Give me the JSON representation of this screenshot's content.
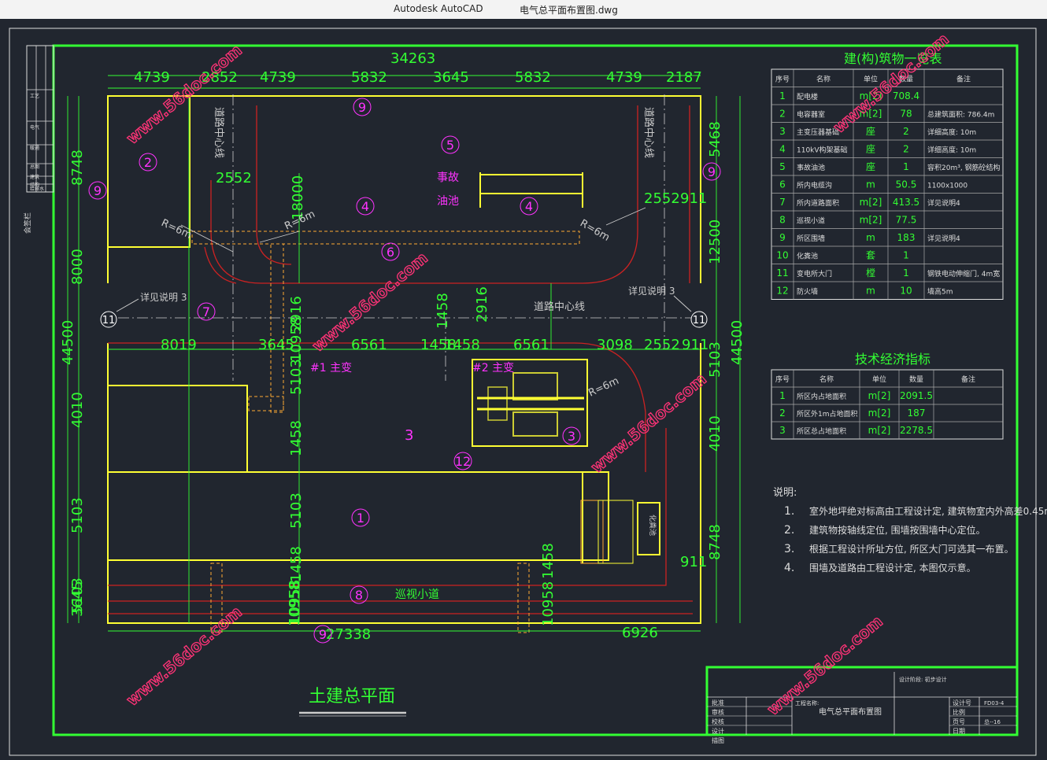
{
  "window": {
    "app_name": "Autodesk AutoCAD",
    "file_name": "电气总平面布置图.dwg"
  },
  "colors": {
    "background": "#21262f",
    "frame": "#33ff33",
    "building": "#ffff33",
    "dimension": "#33ff33",
    "wall": "#cc2222",
    "label": "#ff33ff",
    "watermark": "#ff3377",
    "axis": "#cccccc"
  },
  "drawing": {
    "top_dims": [
      "34263",
      "4739",
      "2852",
      "4739",
      "5832",
      "3645",
      "5832",
      "4739",
      "2187"
    ],
    "left_dims": [
      "8748",
      "8000",
      "44500",
      "4010",
      "5103",
      "5103",
      "3645"
    ],
    "right_dims": [
      "5468",
      "12500",
      "44500",
      "5103",
      "4010",
      "8748"
    ],
    "inner_dims": [
      "2552",
      "18000",
      "2552",
      "911",
      "2916",
      "10958",
      "1458",
      "2916",
      "8019",
      "3645",
      "6561",
      "1458",
      "1458",
      "6561",
      "3098",
      "2552",
      "911",
      "5103",
      "1458",
      "5103",
      "1458",
      "10958",
      "10958",
      "1458",
      "27338",
      "6926",
      "10958",
      "911"
    ],
    "radius_labels": [
      "R=6m",
      "R=6m",
      "R=6m",
      "R=6m"
    ],
    "road_labels": [
      "道路中心线",
      "道路中心线",
      "道路中心线"
    ],
    "callouts": [
      "详见说明 3",
      "详见说明 3"
    ],
    "axis_bubbles": [
      "11",
      "11"
    ],
    "area_labels": {
      "oil_pool_line1": "事故",
      "oil_pool_line2": "油池",
      "transformer1": "#1 主变",
      "transformer2": "#2 主变",
      "patrol_road": "巡视小道",
      "area3": "3",
      "septic": "化粪池"
    },
    "circled_numbers": [
      "9",
      "5",
      "2",
      "9",
      "9",
      "4",
      "4",
      "6",
      "7",
      "3",
      "12",
      "1",
      "8",
      "9"
    ],
    "title": "土建总平面",
    "side_stamp": "会签栏",
    "left_panel_labels": [
      "工艺",
      "电气",
      "暖通",
      "总图",
      "建筑",
      "结构",
      "给排水"
    ]
  },
  "buildings_table": {
    "title": "建(构)筑物一览表",
    "headers": [
      "序号",
      "名称",
      "单位",
      "数量",
      "备注"
    ],
    "rows": [
      [
        "1",
        "配电楼",
        "m[2]",
        "708.4",
        ""
      ],
      [
        "2",
        "电容器室",
        "m[2]",
        "78",
        "总建筑面积: 786.4m"
      ],
      [
        "3",
        "主变压器基础",
        "座",
        "2",
        "详细高度: 10m"
      ],
      [
        "4",
        "110kV构架基础",
        "座",
        "2",
        "详细高度: 10m"
      ],
      [
        "5",
        "事故油池",
        "座",
        "1",
        "容积20m³, 钢筋砼结构"
      ],
      [
        "6",
        "所内电缆沟",
        "m",
        "50.5",
        "1100x1000"
      ],
      [
        "7",
        "所内道路面积",
        "m[2]",
        "413.5",
        "详见说明4"
      ],
      [
        "8",
        "巡视小道",
        "m[2]",
        "77.5",
        ""
      ],
      [
        "9",
        "所区围墙",
        "m",
        "183",
        "详见说明4"
      ],
      [
        "10",
        "化粪池",
        "套",
        "1",
        ""
      ],
      [
        "11",
        "变电所大门",
        "樘",
        "1",
        "钢铁电动伸缩门, 4m宽"
      ],
      [
        "12",
        "防火墙",
        "m",
        "10",
        "墙高5m"
      ]
    ]
  },
  "econ_table": {
    "title": "技术经济指标",
    "headers": [
      "序号",
      "名称",
      "单位",
      "数量",
      "备注"
    ],
    "rows": [
      [
        "1",
        "所区内占地面积",
        "m[2]",
        "2091.5",
        ""
      ],
      [
        "2",
        "所区外1m占地面积",
        "m[2]",
        "187",
        ""
      ],
      [
        "3",
        "所区总占地面积",
        "m[2]",
        "2278.5",
        ""
      ]
    ]
  },
  "notes": {
    "title": "说明:",
    "items": [
      "室外地坪绝对标高由工程设计定, 建筑物室内外高差0.45m。",
      "建筑物按轴线定位, 围墙按围墙中心定位。",
      "根据工程设计所址方位, 所区大门可选其一布置。",
      "围墙及道路由工程设计定, 本图仅示意。"
    ]
  },
  "title_block": {
    "drawing_name": "电气总平面布置图",
    "project_label": "工程名称:",
    "project_value": "设计阶段: 初步设计",
    "left_rows": [
      "批准",
      "审核",
      "校核",
      "设计",
      "描图"
    ],
    "right_rows": [
      "设计号",
      "比例",
      "页号",
      "日期"
    ],
    "right_values": [
      "FD03-4",
      "",
      "总--16",
      ""
    ]
  },
  "watermark": {
    "text": "www.56doc.com"
  }
}
